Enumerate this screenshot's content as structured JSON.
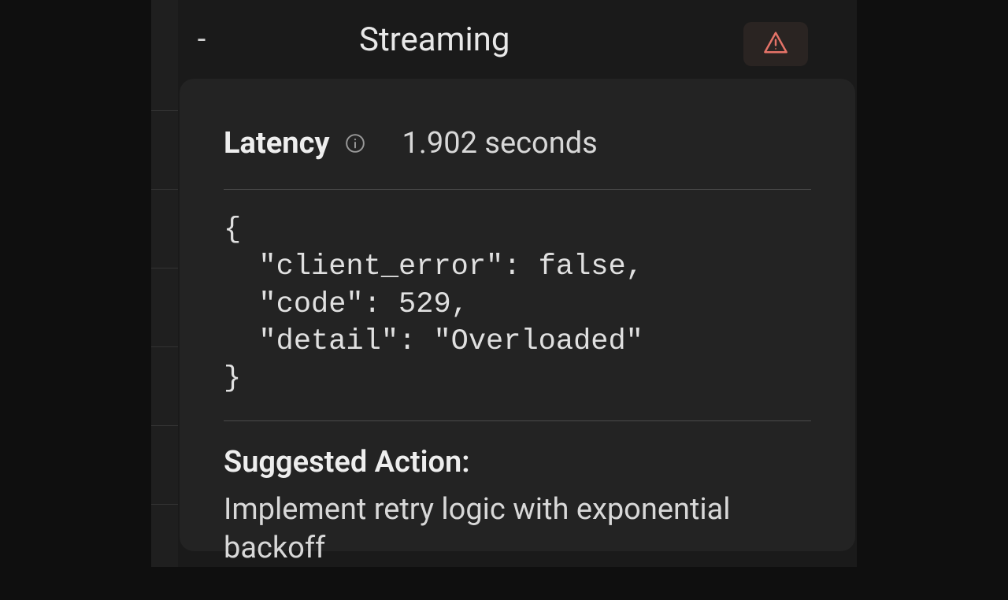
{
  "header": {
    "dash": "-",
    "title": "Streaming"
  },
  "panel": {
    "latency_label": "Latency",
    "latency_value": "1.902 seconds",
    "error_json": "{\n  \"client_error\": false,\n  \"code\": 529,\n  \"detail\": \"Overloaded\"\n}",
    "suggested_label": "Suggested Action:",
    "suggested_text": "Implement retry logic with exponential backoff"
  },
  "icons": {
    "warning": "warning-triangle-icon",
    "info": "info-circle-icon"
  },
  "colors": {
    "bg_outer": "#0f0f0f",
    "bg_frame": "#1a1a1a",
    "bg_panel": "#232323",
    "divider": "#4a4a4a",
    "text_primary": "#eeeeee",
    "text_secondary": "#d8d8d8",
    "warning_accent": "#e57368",
    "warning_bg": "#2a2422"
  }
}
